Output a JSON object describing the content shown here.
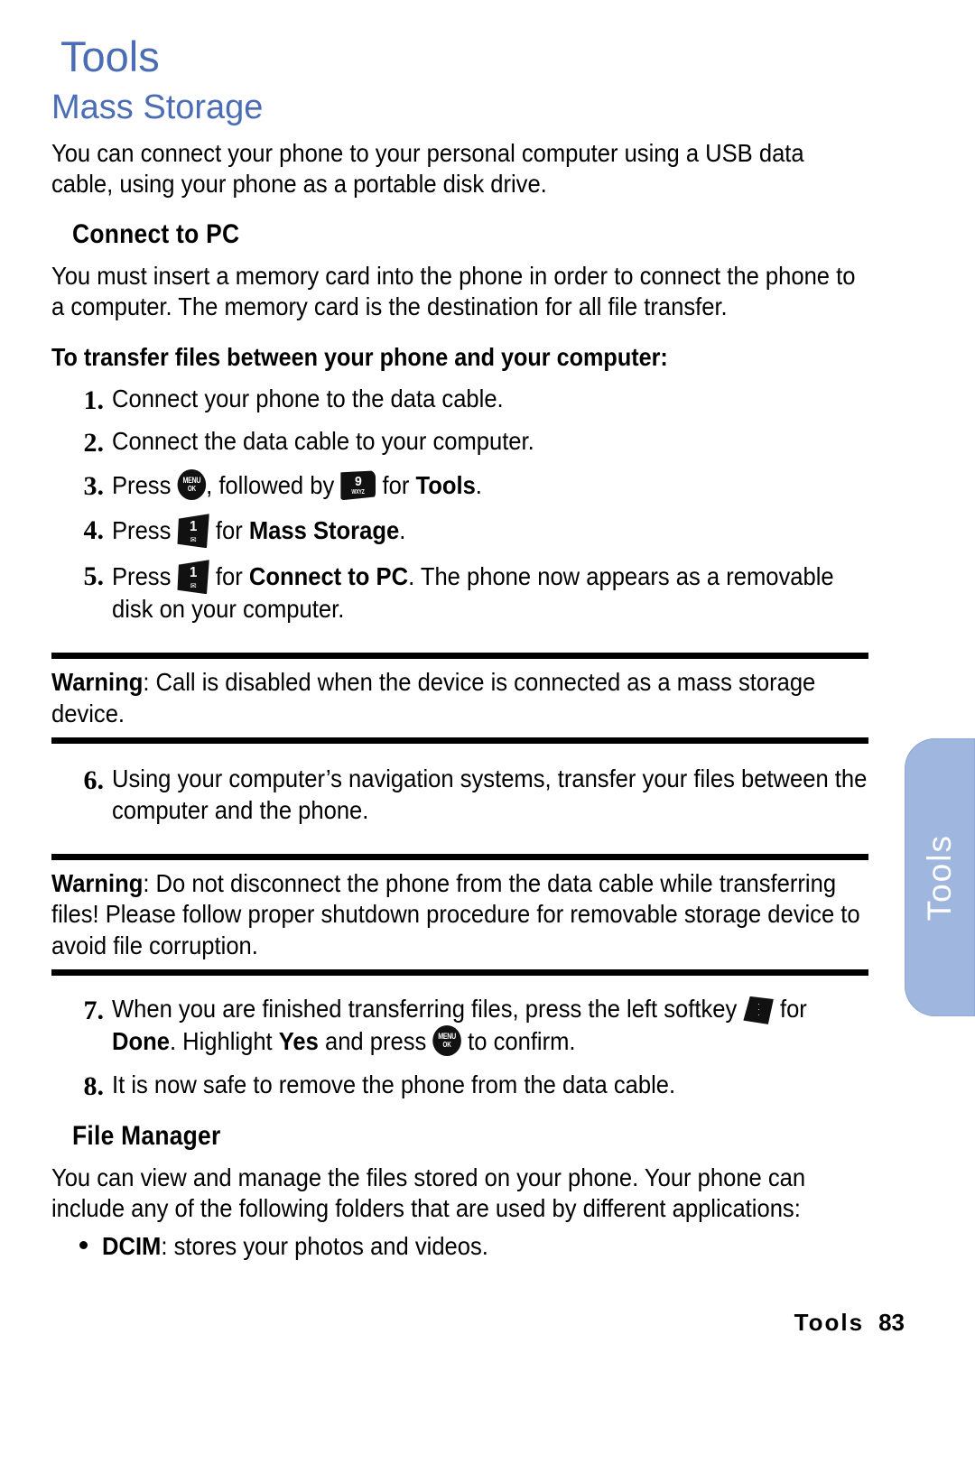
{
  "document": {
    "chapter_title": "Tools",
    "section_title": "Mass Storage",
    "intro_paragraph": "You can connect your phone to your personal computer using a USB data cable, using your phone as a portable disk drive.",
    "subsection_connect": "Connect to PC",
    "connect_paragraph": "You must insert a memory card into the phone in order to connect the phone to a computer. The memory card is the destination for all file transfer.",
    "transfer_lead": "To transfer files between your phone and your computer:",
    "steps_part1": [
      {
        "num": "1.",
        "segments": [
          {
            "type": "text",
            "value": "Connect your phone to the data cable."
          }
        ]
      },
      {
        "num": "2.",
        "segments": [
          {
            "type": "text",
            "value": "Connect the data cable to your computer."
          }
        ]
      },
      {
        "num": "3.",
        "segments": [
          {
            "type": "text",
            "value": "Press "
          },
          {
            "type": "icon",
            "icon": "menu-ok-key",
            "label_top": "MENU",
            "label_bottom": "OK"
          },
          {
            "type": "text",
            "value": ", followed by "
          },
          {
            "type": "icon",
            "icon": "keypad-key-9",
            "digit": "9",
            "letters": "WXYZ"
          },
          {
            "type": "text",
            "value": " for "
          },
          {
            "type": "bold",
            "value": "Tools"
          },
          {
            "type": "text",
            "value": "."
          }
        ]
      },
      {
        "num": "4.",
        "segments": [
          {
            "type": "text",
            "value": "Press "
          },
          {
            "type": "icon",
            "icon": "keypad-key-1",
            "digit": "1",
            "glyph": "envelope"
          },
          {
            "type": "text",
            "value": " for "
          },
          {
            "type": "bold",
            "value": "Mass Storage"
          },
          {
            "type": "text",
            "value": "."
          }
        ]
      },
      {
        "num": "5.",
        "segments": [
          {
            "type": "text",
            "value": "Press "
          },
          {
            "type": "icon",
            "icon": "keypad-key-1",
            "digit": "1",
            "glyph": "envelope"
          },
          {
            "type": "text",
            "value": " for "
          },
          {
            "type": "bold",
            "value": "Connect to PC"
          },
          {
            "type": "text",
            "value": ". The phone now appears as a removable disk on your computer."
          }
        ]
      }
    ],
    "warning_1": {
      "label": "Warning",
      "body": ": Call is disabled when the device is connected as a mass storage device."
    },
    "step_6": {
      "num": "6.",
      "text": "Using your computer’s navigation systems, transfer your files between the computer and the phone."
    },
    "warning_2": {
      "label": "Warning",
      "body": ": Do not disconnect the phone from the data cable while transferring files! Please follow proper shutdown procedure for removable storage device to avoid file corruption."
    },
    "steps_part2": [
      {
        "num": "7.",
        "segments": [
          {
            "type": "text",
            "value": "When you are finished transferring files, press the left softkey "
          },
          {
            "type": "icon",
            "icon": "left-softkey"
          },
          {
            "type": "text",
            "value": " for "
          },
          {
            "type": "bold",
            "value": "Done"
          },
          {
            "type": "text",
            "value": ". Highlight "
          },
          {
            "type": "bold",
            "value": "Yes"
          },
          {
            "type": "text",
            "value": " and press "
          },
          {
            "type": "icon",
            "icon": "menu-ok-key",
            "label_top": "MENU",
            "label_bottom": "OK"
          },
          {
            "type": "text",
            "value": " to confirm."
          }
        ]
      },
      {
        "num": "8.",
        "segments": [
          {
            "type": "text",
            "value": "It is now safe to remove the phone from the data cable."
          }
        ]
      }
    ],
    "subsection_file_manager": "File Manager",
    "file_manager_paragraph": "You can view and manage the files stored on your phone. Your phone can include any of the following folders that are used by different applications:",
    "bullets": [
      {
        "label": "DCIM",
        "rest": ": stores your photos and videos."
      }
    ]
  },
  "side_tab": {
    "label": "Tools",
    "color": "#9fb6de"
  },
  "footer": {
    "chapter": "Tools",
    "page_number": "83"
  },
  "colors": {
    "heading_blue": "#4a6db5",
    "side_tab_blue": "#9fb6de",
    "text_black": "#000000",
    "page_background": "#ffffff"
  }
}
